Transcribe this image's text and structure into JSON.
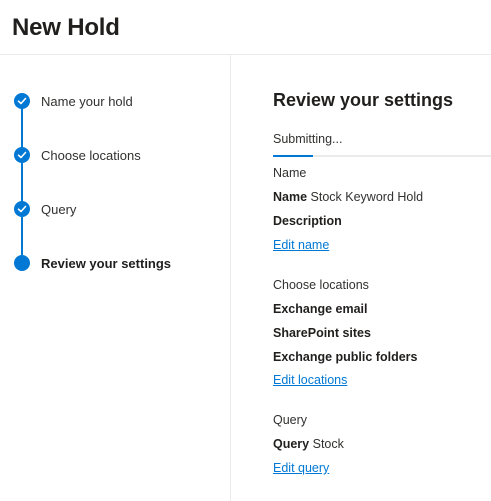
{
  "header": {
    "title": "New Hold"
  },
  "wizard": {
    "steps": [
      {
        "label": "Name your hold",
        "status": "completed"
      },
      {
        "label": "Choose locations",
        "status": "completed"
      },
      {
        "label": "Query",
        "status": "completed"
      },
      {
        "label": "Review your settings",
        "status": "current"
      }
    ],
    "accent_color": "#0078d4"
  },
  "review": {
    "title": "Review your settings",
    "status_text": "Submitting...",
    "progress": {
      "indeterminate": true
    },
    "name_section": {
      "heading": "Name",
      "name_label": "Name",
      "name_value": "Stock Keyword Hold",
      "description_label": "Description",
      "edit_link": "Edit name"
    },
    "locations_section": {
      "heading": "Choose locations",
      "items": [
        "Exchange email",
        "SharePoint sites",
        "Exchange public folders"
      ],
      "edit_link": "Edit locations"
    },
    "query_section": {
      "heading": "Query",
      "query_label": "Query",
      "query_value": "Stock",
      "edit_link": "Edit query"
    }
  }
}
